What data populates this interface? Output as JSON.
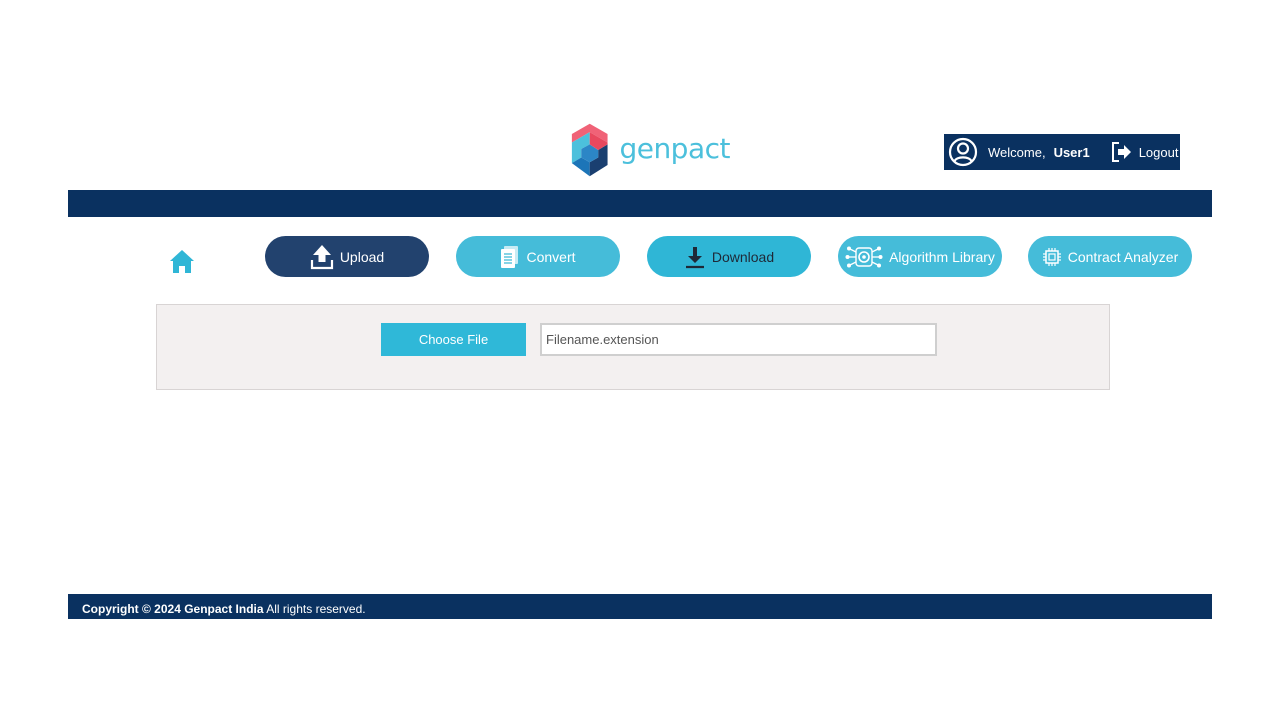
{
  "brand": {
    "name": "genpact"
  },
  "user": {
    "welcome_label": "Welcome,",
    "username": "User1",
    "logout_label": "Logout"
  },
  "nav": {
    "upload": "Upload",
    "convert": "Convert",
    "download": "Download",
    "algorithm_library": "Algorithm Library",
    "contract_analyzer": "Contract Analyzer"
  },
  "upload_panel": {
    "choose_file_label": "Choose File",
    "filename_placeholder": "Filename.extension"
  },
  "footer": {
    "copyright_bold": "Copyright © 2024 Genpact India",
    "rights": " All rights reserved."
  },
  "colors": {
    "navy": "#0a3160",
    "accent": "#45bcd9",
    "upload_active": "#22426e"
  },
  "icons": [
    "home-icon",
    "upload-icon",
    "document-icon",
    "download-icon",
    "network-gear-icon",
    "chip-icon",
    "user-circle-icon",
    "logout-icon"
  ]
}
